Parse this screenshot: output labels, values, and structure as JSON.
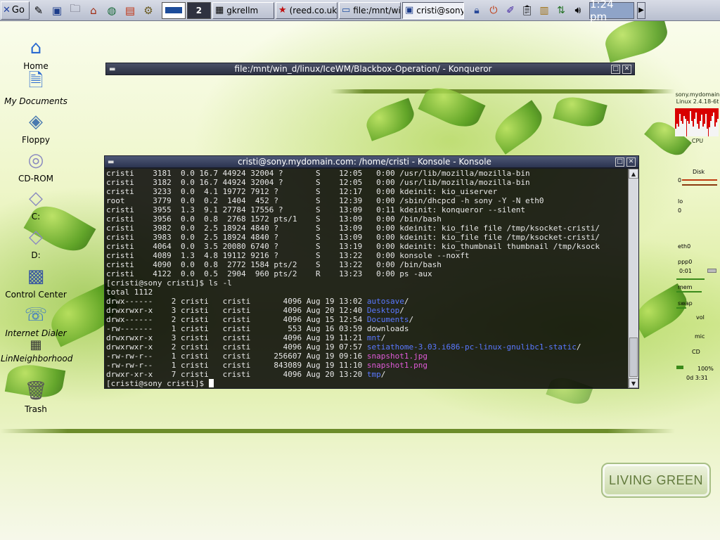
{
  "taskbar": {
    "start_label": "Go",
    "workspace_current": "2",
    "tasks": [
      {
        "icon": "gkrellm-icon",
        "label": "gkrellm"
      },
      {
        "icon": "star-icon",
        "label": "(reed.co.uk"
      },
      {
        "icon": "folder-icon",
        "label": "file:/mnt/wir"
      },
      {
        "icon": "terminal-icon",
        "label": "cristi@sony"
      }
    ],
    "clock": "1:24 pm"
  },
  "desktop_icons": [
    {
      "name": "home",
      "label": "Home",
      "italic": false
    },
    {
      "name": "my-documents",
      "label": "My Documents",
      "italic": true
    },
    {
      "name": "floppy",
      "label": "Floppy",
      "italic": false
    },
    {
      "name": "cd-rom",
      "label": "CD-ROM",
      "italic": false
    },
    {
      "name": "drive-c",
      "label": "C:",
      "italic": false
    },
    {
      "name": "drive-d",
      "label": "D:",
      "italic": false
    },
    {
      "name": "control-center",
      "label": "Control Center",
      "italic": false
    },
    {
      "name": "internet-dialer",
      "label": "Internet Dialer",
      "italic": true
    },
    {
      "name": "lin-neighborhood",
      "label": "LinNeighborhood",
      "italic": true
    },
    {
      "name": "trash",
      "label": "Trash",
      "italic": false
    }
  ],
  "konqueror": {
    "title": "file:/mnt/win_d/linux/IceWM/Blackbox-Operation/ - Konqueror"
  },
  "konsole": {
    "title": "cristi@sony.mydomain.com: /home/cristi - Konsole - Konsole",
    "lines": [
      {
        "text": "cristi    3181  0.0 16.7 44924 32004 ?       S    12:05   0:00 /usr/lib/mozilla/mozilla-bin"
      },
      {
        "text": "cristi    3182  0.0 16.7 44924 32004 ?       S    12:05   0:00 /usr/lib/mozilla/mozilla-bin"
      },
      {
        "text": "cristi    3233  0.0  4.1 19772 7912 ?        S    12:17   0:00 kdeinit: kio_uiserver"
      },
      {
        "text": "root      3779  0.0  0.2  1404  452 ?        S    12:39   0:00 /sbin/dhcpcd -h sony -Y -N eth0"
      },
      {
        "text": "cristi    3955  1.3  9.1 27784 17556 ?       S    13:09   0:11 kdeinit: konqueror --silent"
      },
      {
        "text": "cristi    3956  0.0  0.8  2768 1572 pts/1    S    13:09   0:00 /bin/bash"
      },
      {
        "text": "cristi    3982  0.0  2.5 18924 4840 ?        S    13:09   0:00 kdeinit: kio_file file /tmp/ksocket-cristi/"
      },
      {
        "text": "cristi    3983  0.0  2.5 18924 4840 ?        S    13:09   0:00 kdeinit: kio_file file /tmp/ksocket-cristi/"
      },
      {
        "text": "cristi    4064  0.0  3.5 20080 6740 ?        S    13:19   0:00 kdeinit: kio_thumbnail thumbnail /tmp/ksock"
      },
      {
        "text": "cristi    4089  1.3  4.8 19112 9216 ?        S    13:22   0:00 konsole --noxft"
      },
      {
        "text": "cristi    4090  0.0  0.8  2772 1584 pts/2    S    13:22   0:00 /bin/bash"
      },
      {
        "text": "cristi    4122  0.0  0.5  2904  960 pts/2    R    13:23   0:00 ps -aux"
      },
      {
        "text": "[cristi@sony cristi]$ ls -l"
      },
      {
        "text": "total 1112"
      },
      {
        "text": "drwx------    2 cristi   cristi       4096 Aug 19 13:02 ",
        "name": "autosave",
        "color": "blue",
        "suffix": "/"
      },
      {
        "text": "drwxrwxr-x    3 cristi   cristi       4096 Aug 20 12:40 ",
        "name": "Desktop",
        "color": "blue",
        "suffix": "/"
      },
      {
        "text": "drwx------    2 cristi   cristi       4096 Aug 15 12:54 ",
        "name": "Documents",
        "color": "blue",
        "suffix": "/"
      },
      {
        "text": "-rw-------    1 cristi   cristi        553 Aug 16 03:59 downloads"
      },
      {
        "text": "drwxrwxr-x    3 cristi   cristi       4096 Aug 19 11:21 ",
        "name": "mnt",
        "color": "blue",
        "suffix": "/"
      },
      {
        "text": "drwxrwxr-x    2 cristi   cristi       4096 Aug 19 07:57 ",
        "name": "setiathome-3.03.i686-pc-linux-gnulibc1-static",
        "color": "blue",
        "suffix": "/"
      },
      {
        "text": "-rw-rw-r--    1 cristi   cristi     256607 Aug 19 09:16 ",
        "name": "snapshot1.jpg",
        "color": "pink",
        "suffix": ""
      },
      {
        "text": "-rw-rw-r--    1 cristi   cristi     843089 Aug 19 11:10 ",
        "name": "snapshot1.png",
        "color": "pink",
        "suffix": ""
      },
      {
        "text": "drwxr-xr-x    7 cristi   cristi       4096 Aug 20 13:20 ",
        "name": "tmp",
        "color": "blue",
        "suffix": "/"
      },
      {
        "text": "[cristi@sony cristi]$ ",
        "cursor": true
      }
    ]
  },
  "gkrellm": {
    "host": "sony.mydomain",
    "kernel": "Linux 2.4.18-6t",
    "cpu_label": "CPU",
    "disk_label": "Disk",
    "labels": {
      "zero1": "0",
      "zero2": "0",
      "lo": "lo",
      "zero3": "0",
      "eth0": "eth0",
      "ppp0": "ppp0",
      "ppp_time": "0:01",
      "mem": "mem",
      "swap": "swap",
      "vol": "vol",
      "mic": "mic",
      "cd": "CD",
      "battery": "100%",
      "uptime": "0d 3:31"
    },
    "cpu_samples": [
      0.3,
      0.5,
      0.4,
      0.9,
      0.6,
      0.5,
      0.8,
      0.7,
      0.6,
      0.5,
      1.0,
      0.6,
      0.4,
      0.7,
      0.95,
      0.5,
      0.3,
      0.6,
      0.85,
      0.4,
      0.5,
      0.9,
      0.3,
      0.35,
      0.6,
      0.8,
      0.95,
      0.4,
      0.55,
      0.7
    ]
  },
  "wallpaper_badge": "LIVING GREEN",
  "colors": {
    "term_blue": "#5a78ff",
    "term_pink": "#e05ad8",
    "gk_cpu": "#d80000"
  }
}
